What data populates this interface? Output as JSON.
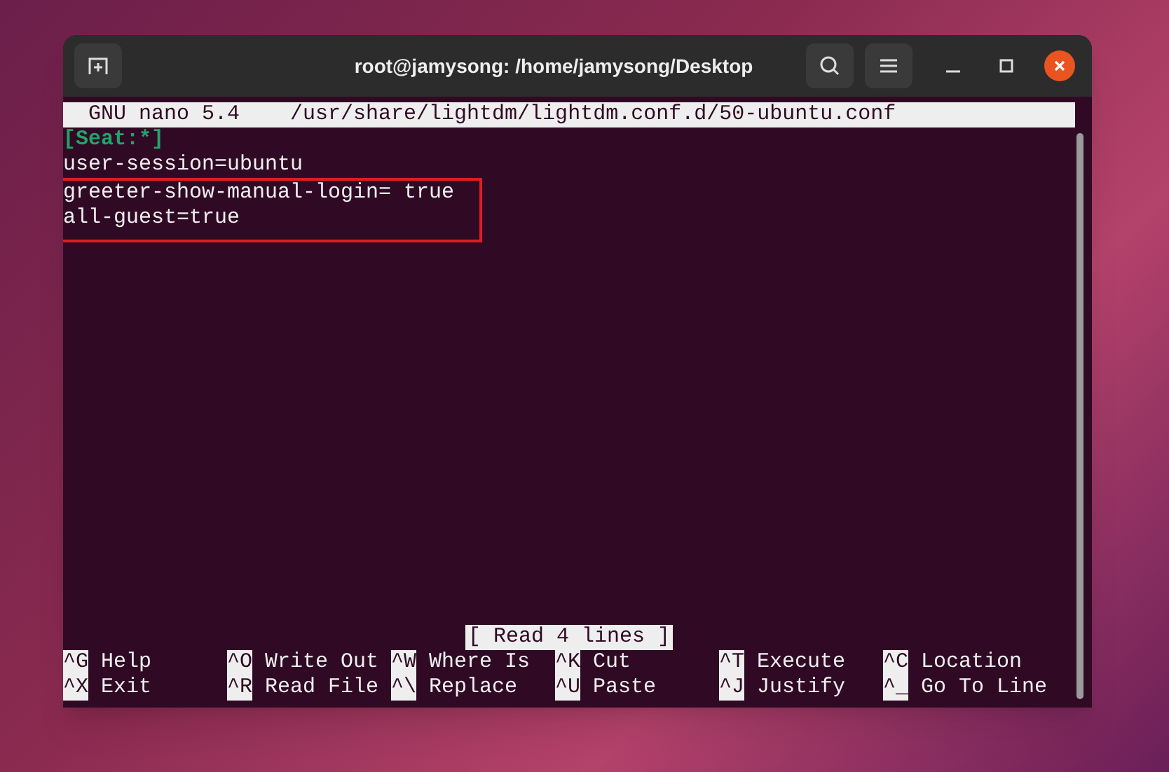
{
  "window": {
    "title": "root@jamysong: /home/jamysong/Desktop"
  },
  "nano": {
    "program": "GNU nano 5.4",
    "file": "/usr/share/lightdm/lightdm.conf.d/50-ubuntu.conf",
    "lines": [
      {
        "text": "[Seat:*]",
        "kind": "section",
        "boxed": false
      },
      {
        "text": "user-session=ubuntu",
        "kind": "plain",
        "boxed": false
      },
      {
        "text": "greeter-show-manual-login= true",
        "kind": "plain",
        "boxed": true
      },
      {
        "text": "all-guest=true",
        "kind": "plain",
        "boxed": true
      }
    ],
    "status": "[ Read 4 lines ]",
    "shortcuts": [
      {
        "key": "^G",
        "label": "Help"
      },
      {
        "key": "^O",
        "label": "Write Out"
      },
      {
        "key": "^W",
        "label": "Where Is"
      },
      {
        "key": "^K",
        "label": "Cut"
      },
      {
        "key": "^T",
        "label": "Execute"
      },
      {
        "key": "^C",
        "label": "Location"
      },
      {
        "key": "^X",
        "label": "Exit"
      },
      {
        "key": "^R",
        "label": "Read File"
      },
      {
        "key": "^\\",
        "label": "Replace"
      },
      {
        "key": "^U",
        "label": "Paste"
      },
      {
        "key": "^J",
        "label": "Justify"
      },
      {
        "key": "^_",
        "label": "Go To Line"
      }
    ]
  }
}
